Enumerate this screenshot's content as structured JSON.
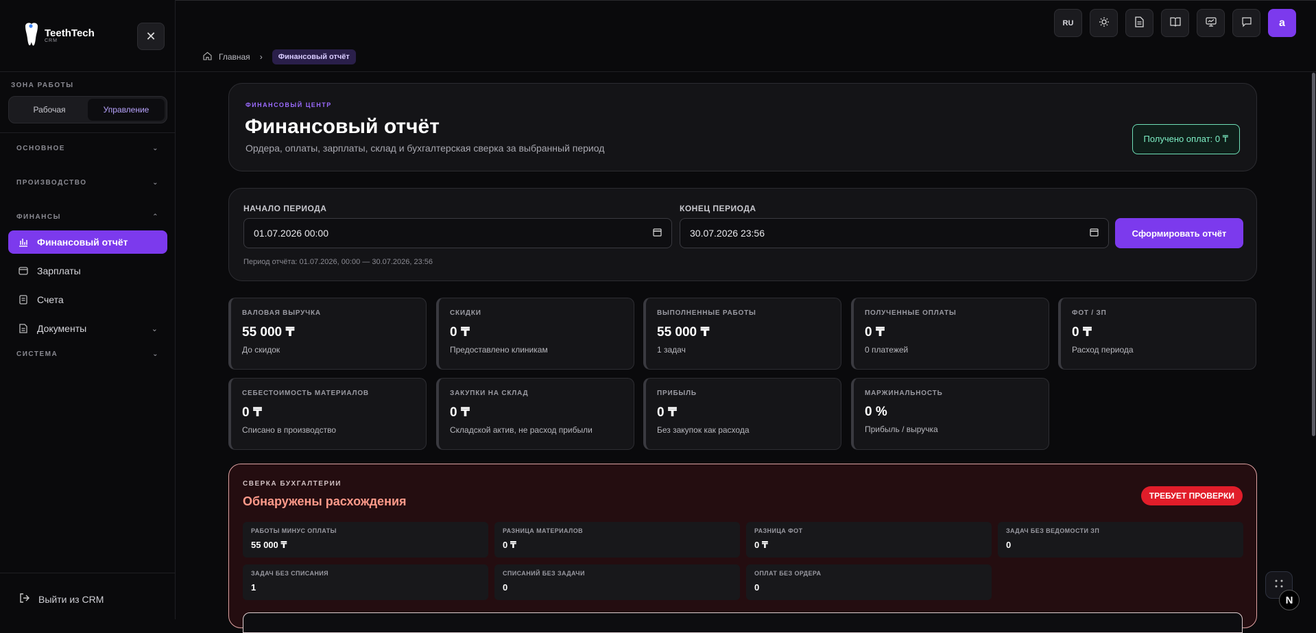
{
  "app": {
    "name": "TeethTech",
    "sub": "CRM"
  },
  "sidebar": {
    "zone_label": "ЗОНА РАБОТЫ",
    "zone_options": [
      "Рабочая",
      "Управление"
    ],
    "zone_active": "Управление",
    "sections": {
      "main": "ОСНОВНОЕ",
      "production": "ПРОИЗВОДСТВО",
      "finance": "ФИНАНСЫ",
      "system": "СИСТЕМА"
    },
    "items": [
      "Финансовый отчёт",
      "Зарплаты",
      "Счета",
      "Документы"
    ],
    "logout": "Выйти из CRM"
  },
  "topbar": {
    "lang": "RU",
    "avatar": "a",
    "icons": [
      "sun-icon",
      "document-icon",
      "book-icon",
      "monitor-icon",
      "chat-icon"
    ]
  },
  "breadcrumb": {
    "home": "Главная",
    "current": "Финансовый отчёт"
  },
  "hero": {
    "eyebrow": "ФИНАНСОВЫЙ ЦЕНТР",
    "title": "Финансовый отчёт",
    "subtitle": "Ордера, оплаты, зарплаты, склад и бухгалтерская сверка за выбранный период",
    "badge": "Получено оплат: 0 ₸"
  },
  "period": {
    "start_label": "НАЧАЛО ПЕРИОДА",
    "start_value": "01.07.2026 00:00",
    "end_label": "КОНЕЦ ПЕРИОДА",
    "end_value": "30.07.2026 23:56",
    "button": "Сформировать отчёт",
    "note": "Период отчёта: 01.07.2026, 00:00 — 30.07.2026, 23:56"
  },
  "kpis": [
    {
      "label": "ВАЛОВАЯ ВЫРУЧКА",
      "value": "55 000 ₸",
      "sub": "До скидок"
    },
    {
      "label": "СКИДКИ",
      "value": "0 ₸",
      "sub": "Предоставлено клиникам"
    },
    {
      "label": "ВЫПОЛНЕННЫЕ РАБОТЫ",
      "value": "55 000 ₸",
      "sub": "1 задач"
    },
    {
      "label": "ПОЛУЧЕННЫЕ ОПЛАТЫ",
      "value": "0 ₸",
      "sub": "0 платежей"
    },
    {
      "label": "ФОТ / ЗП",
      "value": "0 ₸",
      "sub": "Расход периода"
    },
    {
      "label": "СЕБЕСТОИМОСТЬ МАТЕРИАЛОВ",
      "value": "0 ₸",
      "sub": "Списано в производство"
    },
    {
      "label": "ЗАКУПКИ НА СКЛАД",
      "value": "0 ₸",
      "sub": "Складской актив, не расход прибыли"
    },
    {
      "label": "ПРИБЫЛЬ",
      "value": "0 ₸",
      "sub": "Без закупок как расхода"
    },
    {
      "label": "МАРЖИНАЛЬНОСТЬ",
      "value": "0 %",
      "sub": "Прибыль / выручка"
    }
  ],
  "reconciliation": {
    "eyebrow": "СВЕРКА БУХГАЛТЕРИИ",
    "title": "Обнаружены расхождения",
    "badge": "ТРЕБУЕТ ПРОВЕРКИ",
    "items": [
      {
        "label": "РАБОТЫ МИНУС ОПЛАТЫ",
        "value": "55 000 ₸"
      },
      {
        "label": "РАЗНИЦА МАТЕРИАЛОВ",
        "value": "0 ₸"
      },
      {
        "label": "РАЗНИЦА ФОТ",
        "value": "0 ₸"
      },
      {
        "label": "ЗАДАЧ БЕЗ ВЕДОМОСТИ ЗП",
        "value": "0"
      },
      {
        "label": "ЗАДАЧ БЕЗ СПИСАНИЯ",
        "value": "1"
      },
      {
        "label": "СПИСАНИЙ БЕЗ ЗАДАЧИ",
        "value": "0"
      },
      {
        "label": "ОПЛАТ БЕЗ ОРДЕРА",
        "value": "0"
      }
    ]
  },
  "colors": {
    "accent": "#7c3aed",
    "success": "#7ef0c6",
    "danger": "#e11d2a",
    "alert_text": "#ff9a8a"
  },
  "floating": {
    "next_badge": "N"
  }
}
